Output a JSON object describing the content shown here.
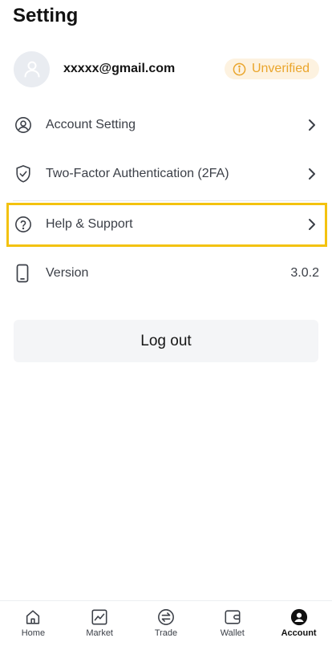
{
  "header": {
    "title": "Setting"
  },
  "profile": {
    "email": "xxxxx@gmail.com",
    "badge": "Unverified",
    "badge_color": "#eaa52b"
  },
  "menu": {
    "account_setting": {
      "label": "Account Setting",
      "icon": "user-circle-icon"
    },
    "two_factor": {
      "label": "Two-Factor Authentication (2FA)",
      "icon": "shield-check-icon"
    },
    "help": {
      "label": "Help & Support",
      "icon": "question-circle-icon"
    },
    "version": {
      "label": "Version",
      "value": "3.0.2",
      "icon": "phone-icon"
    }
  },
  "logout": {
    "label": "Log out"
  },
  "highlight_color": "#f3c20f",
  "nav": {
    "home": "Home",
    "market": "Market",
    "trade": "Trade",
    "wallet": "Wallet",
    "account": "Account",
    "active": "account"
  }
}
